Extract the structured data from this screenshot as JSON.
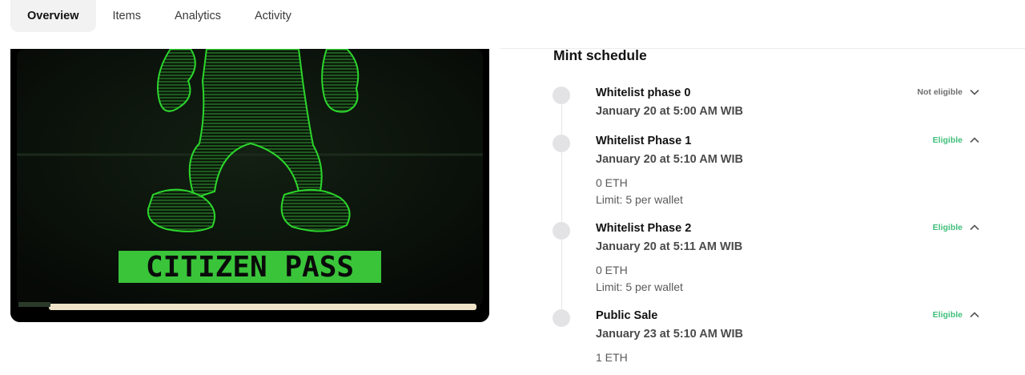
{
  "tabs": [
    {
      "label": "Overview",
      "active": true
    },
    {
      "label": "Items",
      "active": false
    },
    {
      "label": "Analytics",
      "active": false
    },
    {
      "label": "Activity",
      "active": false
    }
  ],
  "artwork": {
    "banner_text": "CITIZEN PASS",
    "colors": {
      "background": "#0b130b",
      "neon": "#2bd62b",
      "banner": "#3ac43a",
      "banner_text": "#0a0a0a",
      "tray": "#efe4c8"
    }
  },
  "schedule": {
    "title": "Mint schedule",
    "phases": [
      {
        "name": "Whitelist phase 0",
        "date": "January 20 at 5:00 AM WIB",
        "status": "Not eligible",
        "expanded": false,
        "price": "",
        "limit": ""
      },
      {
        "name": "Whitelist Phase 1",
        "date": "January 20 at 5:10 AM WIB",
        "status": "Eligible",
        "expanded": true,
        "price": "0 ETH",
        "limit": "Limit: 5 per wallet"
      },
      {
        "name": "Whitelist Phase 2",
        "date": "January 20 at 5:11 AM WIB",
        "status": "Eligible",
        "expanded": true,
        "price": "0 ETH",
        "limit": "Limit: 5 per wallet"
      },
      {
        "name": "Public Sale",
        "date": "January 23 at 5:10 AM WIB",
        "status": "Eligible",
        "expanded": true,
        "price": "1 ETH",
        "limit": ""
      }
    ],
    "colors": {
      "eligible": "#3fbf7a",
      "not_eligible": "#6e6e6e"
    }
  },
  "icons": {
    "collapsed": "chevron-down-icon",
    "expanded": "chevron-up-icon"
  }
}
